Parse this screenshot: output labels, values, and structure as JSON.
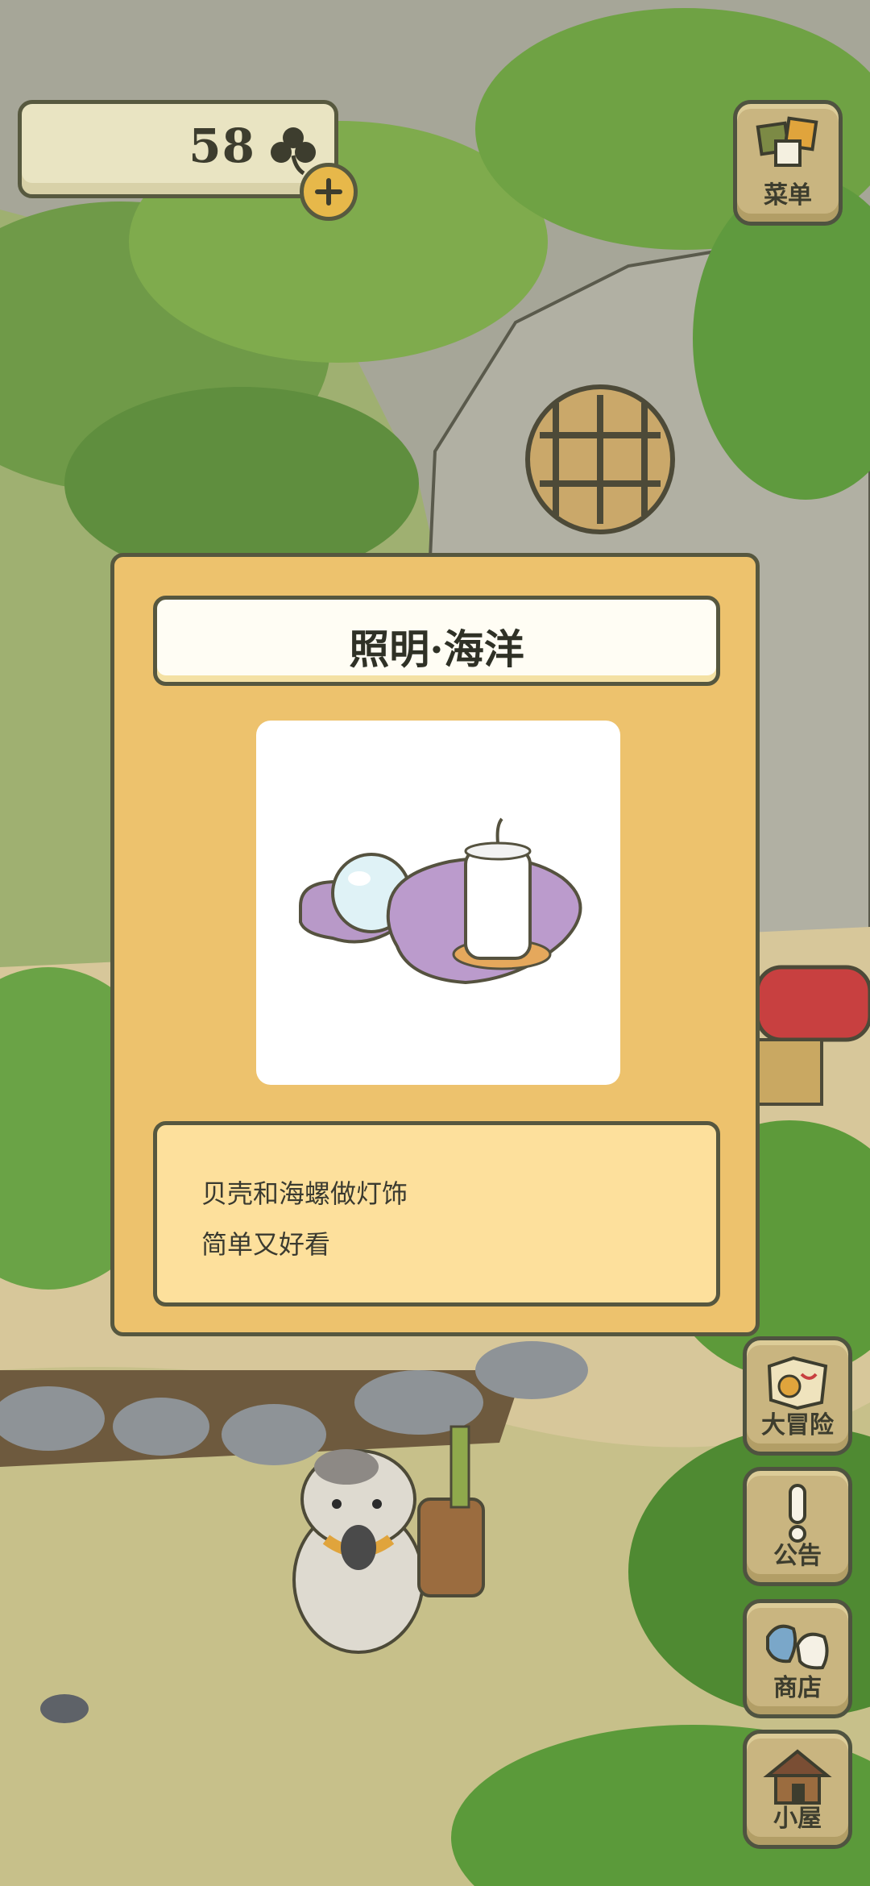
{
  "currency": {
    "amount": "58",
    "icon": "clover-icon",
    "add_icon": "plus-icon"
  },
  "menu_button": {
    "label": "菜单",
    "icon": "menu-cards-icon"
  },
  "item_dialog": {
    "title": "照明·海洋",
    "image": "shell-candle-pearl-lamp",
    "description_lines": [
      "贝壳和海螺做灯饰",
      "简单又好看"
    ]
  },
  "side_buttons": [
    {
      "label": "大冒险",
      "icon": "map-icon"
    },
    {
      "label": "公告",
      "icon": "exclamation-icon"
    },
    {
      "label": "商店",
      "icon": "shop-bags-icon"
    },
    {
      "label": "小屋",
      "icon": "house-icon"
    }
  ],
  "colors": {
    "panel": "#edc26d",
    "title_bg": "#fffdf4",
    "desc_bg": "#fde09c",
    "outline": "#56573f",
    "button": "#c9b580"
  }
}
